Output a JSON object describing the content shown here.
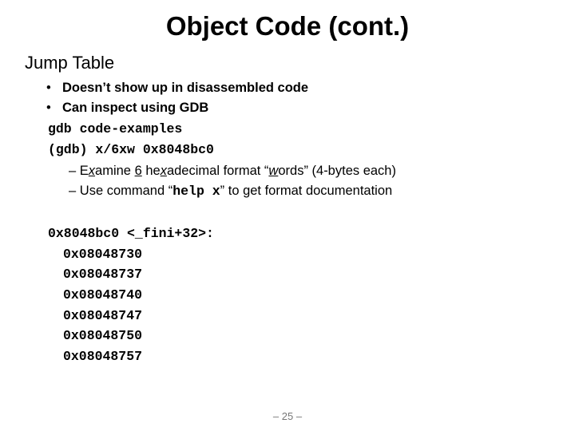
{
  "slide": {
    "title": "Object Code (cont.)",
    "heading": "Jump Table",
    "bullets": [
      {
        "marker": "•",
        "text": "Doesn’t show up in disassembled code"
      },
      {
        "marker": "•",
        "text": "Can inspect using GDB"
      }
    ],
    "commands": [
      "gdb code-examples",
      "(gdb) x/6xw 0x8048bc0"
    ],
    "sub_items": {
      "examine": {
        "dash": "–",
        "e": "E",
        "x1": "x",
        "amine": "amine ",
        "six": "6",
        "he": " he",
        "x2": "x",
        "adecimal": "adecimal format “",
        "w": "w",
        "ords": "ords” (4-bytes each)"
      },
      "help": {
        "dash": "–",
        "pre": "Use command “",
        "cmd": "help x",
        "post": "” to get format documentation"
      }
    },
    "dump_header": "0x8048bc0 <_fini+32>:",
    "dump_values": [
      "0x08048730",
      "0x08048737",
      "0x08048740",
      "0x08048747",
      "0x08048750",
      "0x08048757"
    ],
    "page_number": "– 25 –"
  }
}
